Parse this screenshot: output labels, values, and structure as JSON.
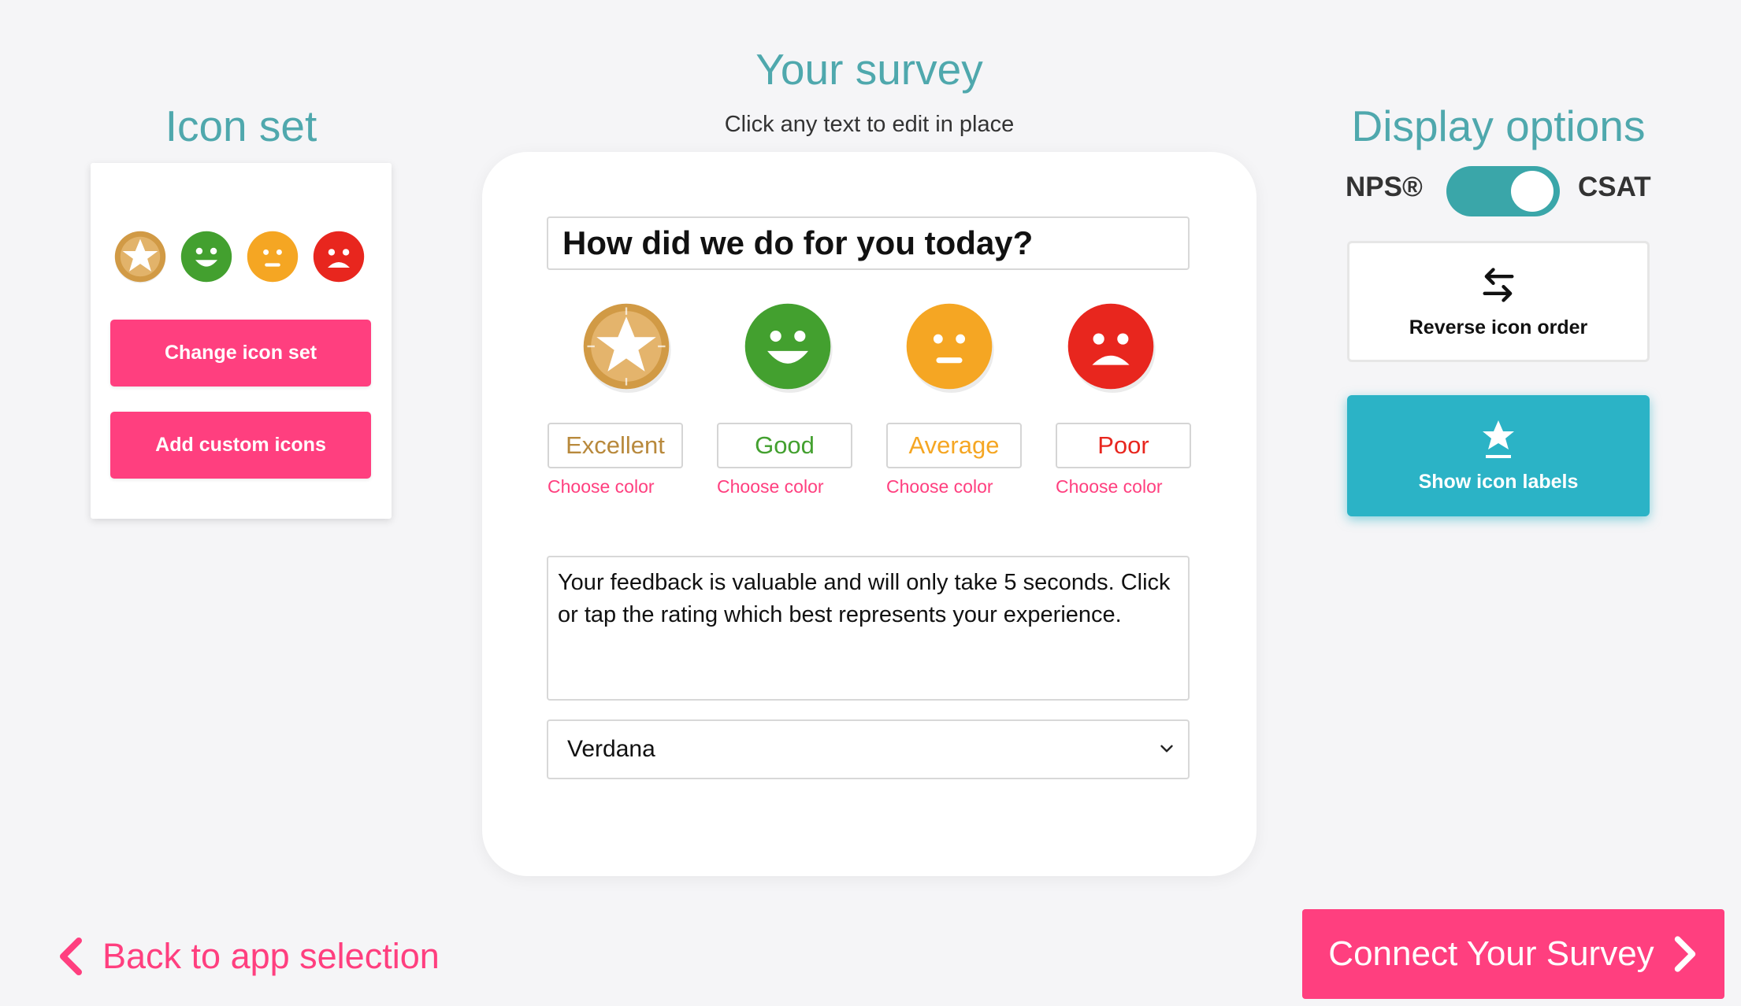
{
  "icon_set": {
    "title": "Icon set",
    "change_label": "Change icon set",
    "custom_label": "Add custom icons",
    "icons": [
      "star-icon",
      "happy-face-icon",
      "neutral-face-icon",
      "sad-face-icon"
    ]
  },
  "survey": {
    "title": "Your survey",
    "subtitle": "Click any text to edit in place",
    "question": "How did we do for you today?",
    "ratings": [
      {
        "label": "Excellent",
        "color": "#b8893c",
        "choose": "Choose color",
        "icon": "star-icon"
      },
      {
        "label": "Good",
        "color": "#43a02f",
        "choose": "Choose color",
        "icon": "happy-face-icon"
      },
      {
        "label": "Average",
        "color": "#f5a623",
        "choose": "Choose color",
        "icon": "neutral-face-icon"
      },
      {
        "label": "Poor",
        "color": "#e8261e",
        "choose": "Choose color",
        "icon": "sad-face-icon"
      }
    ],
    "description": "Your feedback is valuable and will only take 5 seconds. Click or tap the rating which best represents your experience.",
    "font_select": "Verdana"
  },
  "display": {
    "title": "Display options",
    "toggle_left": "NPS®",
    "toggle_right": "CSAT",
    "toggle_state": "CSAT",
    "reverse_label": "Reverse icon order",
    "labels_label": "Show icon labels"
  },
  "footer": {
    "back_label": "Back to app selection",
    "connect_label": "Connect Your Survey"
  },
  "colors": {
    "accent_pink": "#ff3f7f",
    "accent_teal": "#2bb3c6",
    "heading_teal": "#4fa8ad"
  }
}
